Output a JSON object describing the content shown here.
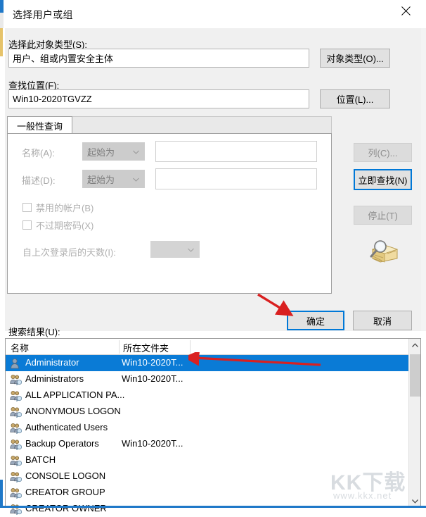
{
  "window": {
    "title": "选择用户或组",
    "close_icon": "close-icon"
  },
  "object_type": {
    "label": "选择此对象类型(S):",
    "value": "用户、组或内置安全主体",
    "button": "对象类型(O)..."
  },
  "location": {
    "label": "查找位置(F):",
    "value": "Win10-2020TGVZZ",
    "button": "位置(L)..."
  },
  "tabs": [
    {
      "label": "一般性查询"
    }
  ],
  "query": {
    "name_label": "名称(A):",
    "name_condition": "起始为",
    "name_value": "",
    "desc_label": "描述(D):",
    "desc_condition": "起始为",
    "desc_value": "",
    "disabled_accounts": "禁用的帐户(B)",
    "non_expiring_password": "不过期密码(X)",
    "days_since_logon_label": "自上次登录后的天数(I):",
    "days_since_logon_value": ""
  },
  "side_buttons": {
    "columns": "列(C)...",
    "find_now": "立即查找(N)",
    "stop": "停止(T)",
    "icon": "magnifier-folder-icon"
  },
  "dialog_buttons": {
    "ok": "确定",
    "cancel": "取消"
  },
  "results": {
    "label": "搜索结果(U):",
    "columns": [
      "名称",
      "所在文件夹"
    ],
    "rows": [
      {
        "name": "Administrator",
        "folder": "Win10-2020T...",
        "icon": "user-icon",
        "selected": true
      },
      {
        "name": "Administrators",
        "folder": "Win10-2020T...",
        "icon": "group-icon",
        "selected": false
      },
      {
        "name": "ALL APPLICATION PA...",
        "folder": "",
        "icon": "group-icon",
        "selected": false
      },
      {
        "name": "ANONYMOUS LOGON",
        "folder": "",
        "icon": "group-icon",
        "selected": false
      },
      {
        "name": "Authenticated Users",
        "folder": "",
        "icon": "group-icon",
        "selected": false
      },
      {
        "name": "Backup Operators",
        "folder": "Win10-2020T...",
        "icon": "group-icon",
        "selected": false
      },
      {
        "name": "BATCH",
        "folder": "",
        "icon": "group-icon",
        "selected": false
      },
      {
        "name": "CONSOLE LOGON",
        "folder": "",
        "icon": "group-icon",
        "selected": false
      },
      {
        "name": "CREATOR GROUP",
        "folder": "",
        "icon": "group-icon",
        "selected": false
      },
      {
        "name": "CREATOR OWNER",
        "folder": "",
        "icon": "group-icon",
        "selected": false
      }
    ]
  },
  "watermark": {
    "big": "KK下载",
    "small": "www.kkx.net"
  },
  "annotations": {
    "arrow_to_ok": "red-arrow-icon",
    "arrow_to_selected_row": "red-arrow-icon"
  },
  "colors": {
    "accent": "#0078d7",
    "selection": "#0a7bd6",
    "annotation": "#d92020",
    "dialog_bg": "#f0f0f0"
  }
}
